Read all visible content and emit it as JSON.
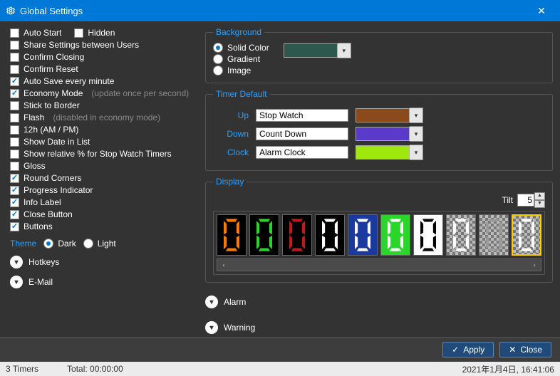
{
  "window": {
    "title": "Global Settings"
  },
  "options": [
    {
      "label": "Auto Start",
      "checked": false
    },
    {
      "label": "Hidden",
      "checked": false,
      "inline_after_prev": true
    },
    {
      "label": "Share Settings between Users",
      "checked": false
    },
    {
      "label": "Confirm Closing",
      "checked": false
    },
    {
      "label": "Confirm Reset",
      "checked": false
    },
    {
      "label": "Auto Save every minute",
      "checked": true
    },
    {
      "label": "Economy Mode",
      "checked": true,
      "hint": "(update once per second)"
    },
    {
      "label": "Stick to Border",
      "checked": false
    },
    {
      "label": "Flash",
      "checked": false,
      "hint": "(disabled in economy mode)"
    },
    {
      "label": "12h (AM / PM)",
      "checked": false
    },
    {
      "label": "Show Date in List",
      "checked": false
    },
    {
      "label": "Show relative % for Stop Watch Timers",
      "checked": false
    },
    {
      "label": "Gloss",
      "checked": false
    },
    {
      "label": "Round Corners",
      "checked": true
    },
    {
      "label": "Progress Indicator",
      "checked": true
    },
    {
      "label": "Info Label",
      "checked": true
    },
    {
      "label": "Close Button",
      "checked": true
    },
    {
      "label": "Buttons",
      "checked": true
    }
  ],
  "theme": {
    "label": "Theme",
    "options": [
      "Dark",
      "Light"
    ],
    "selected": "Dark"
  },
  "sections": {
    "hotkeys": "Hotkeys",
    "email": "E-Mail",
    "alarm": "Alarm",
    "warning": "Warning"
  },
  "background": {
    "legend": "Background",
    "opts": [
      "Solid Color",
      "Gradient",
      "Image"
    ],
    "selected": "Solid Color",
    "color": "#2d584e"
  },
  "timer_default": {
    "legend": "Timer Default",
    "rows": [
      {
        "label": "Up",
        "value": "Stop Watch",
        "color": "#8a4a1a"
      },
      {
        "label": "Down",
        "value": "Count Down",
        "color": "#5a3bc9"
      },
      {
        "label": "Clock",
        "value": "Alarm Clock",
        "color": "#9fe80e"
      }
    ]
  },
  "display": {
    "legend": "Display",
    "tilt_label": "Tilt",
    "tilt_value": "5",
    "styles": [
      {
        "bg": "#000000",
        "fg": "#ff7a00"
      },
      {
        "bg": "#000000",
        "fg": "#29d629"
      },
      {
        "bg": "#000000",
        "fg": "#c01a1a"
      },
      {
        "bg": "#000000",
        "fg": "#ffffff"
      },
      {
        "bg": "#1b3aa0",
        "fg": "#ffffff"
      },
      {
        "bg": "#2bd62b",
        "fg": "#ffffff"
      },
      {
        "bg": "#ffffff",
        "fg": "#000000"
      },
      {
        "bg": "checker",
        "fg": "#ffffff"
      },
      {
        "bg": "checker",
        "fg": "#9a9a9a"
      },
      {
        "bg": "checker",
        "fg": "#ffffff",
        "selected": true
      }
    ]
  },
  "footer": {
    "apply": "Apply",
    "close": "Close"
  },
  "status": {
    "left": "3 Timers",
    "mid": "Total: 00:00:00",
    "right": "2021年1月4日, 16:41:06"
  }
}
